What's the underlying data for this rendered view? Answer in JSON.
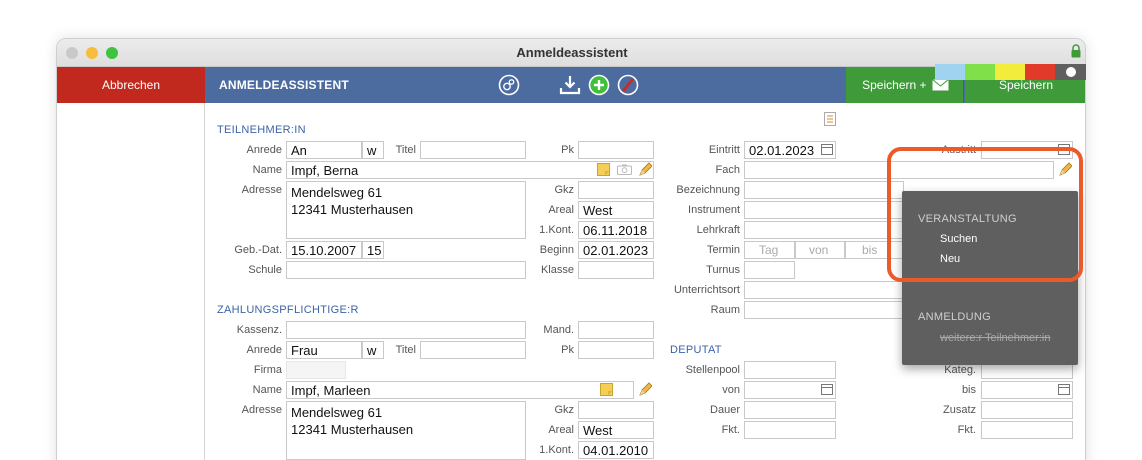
{
  "window": {
    "title": "Anmeldeassistent"
  },
  "toolbar": {
    "cancel_label": "Abbrechen",
    "title": "ANMELDEASSISTENT",
    "save_mail_label": "Speichern +",
    "save_label": "Speichern"
  },
  "colors": {
    "accent": "#4c6c9f",
    "cancel": "#c1281e",
    "save": "#3f9a3a",
    "highlight": "#ec5a2a",
    "section": "#3b63a7"
  },
  "swatches": [
    "#9fd3ef",
    "#7fe04a",
    "#f2ec3c",
    "#e23a2a",
    "#5f5f5f"
  ],
  "teilnehmer": {
    "section": "TEILNEHMER:IN",
    "anrede_label": "Anrede",
    "anrede": "An",
    "gender": "w",
    "titel_label": "Titel",
    "pk_label": "Pk",
    "name_label": "Name",
    "name": "Impf, Berna",
    "adresse_label": "Adresse",
    "adresse": "Mendelsweg 61\n12341 Musterhausen",
    "gkz_label": "Gkz",
    "areal_label": "Areal",
    "areal": "West",
    "kont_label": "1.Kont.",
    "kont": "06.11.2018",
    "geb_label": "Geb.-Dat.",
    "geb": "15.10.2007",
    "alter": "15",
    "beginn_label": "Beginn",
    "beginn": "02.01.2023",
    "schule_label": "Schule",
    "klasse_label": "Klasse"
  },
  "kurs": {
    "eintritt_label": "Eintritt",
    "eintritt": "02.01.2023",
    "austritt_label": "Austritt",
    "fach_label": "Fach",
    "bezeichnung_label": "Bezeichnung",
    "instrument_label": "Instrument",
    "lehrkraft_label": "Lehrkraft",
    "termin_label": "Termin",
    "termin_tag_ph": "Tag",
    "termin_von_ph": "von",
    "termin_bis_ph": "bis",
    "turnus_label": "Turnus",
    "unterrichtsort_label": "Unterrichtsort",
    "raum_label": "Raum"
  },
  "zahlung": {
    "section": "ZAHLUNGSPFLICHTIGE:R",
    "kassenz_label": "Kassenz.",
    "mand_label": "Mand.",
    "anrede_label": "Anrede",
    "anrede": "Frau",
    "gender": "w",
    "titel_label": "Titel",
    "pk_label": "Pk",
    "firma_label": "Firma",
    "name_label": "Name",
    "name": "Impf, Marleen",
    "adresse_label": "Adresse",
    "adresse": "Mendelsweg 61\n12341 Musterhausen",
    "gkz_label": "Gkz",
    "areal_label": "Areal",
    "areal": "West",
    "kont_label": "1.Kont.",
    "kont": "04.01.2010"
  },
  "deputat": {
    "section": "DEPUTAT",
    "stellenpool_label": "Stellenpool",
    "von_label": "von",
    "dauer_label": "Dauer",
    "fkt_label": "Fkt.",
    "kateg_label": "Kateg.",
    "bis_label": "bis",
    "zusatz_label": "Zusatz",
    "fkt2_label": "Fkt."
  },
  "menu": {
    "veranstaltung_head": "VERANSTALTUNG",
    "suchen": "Suchen",
    "neu": "Neu",
    "anmeldung_head": "ANMELDUNG",
    "weitere": "weitere:r Teilnehmer:in"
  }
}
